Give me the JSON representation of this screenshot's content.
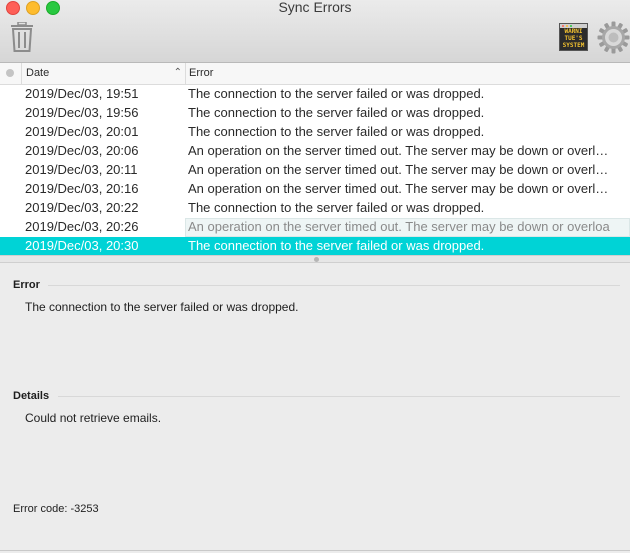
{
  "window": {
    "title": "Sync Errors"
  },
  "toolbar": {
    "console_icon_text": [
      "WARNI",
      "TUE'S",
      "SYSTEM"
    ],
    "colors": {
      "selection": "#00d3d6"
    }
  },
  "table": {
    "columns": {
      "date": "Date",
      "error": "Error"
    },
    "rows": [
      {
        "date": "2019/Dec/03, 19:51",
        "error": "The connection to the server failed or was dropped."
      },
      {
        "date": "2019/Dec/03, 19:56",
        "error": "The connection to the server failed or was dropped."
      },
      {
        "date": "2019/Dec/03, 20:01",
        "error": "The connection to the server failed or was dropped."
      },
      {
        "date": "2019/Dec/03, 20:06",
        "error": "An operation on the server timed out. The server may be down or overl…"
      },
      {
        "date": "2019/Dec/03, 20:11",
        "error": "An operation on the server timed out. The server may be down or overl…"
      },
      {
        "date": "2019/Dec/03, 20:16",
        "error": "An operation on the server timed out. The server may be down or overl…"
      },
      {
        "date": "2019/Dec/03, 20:22",
        "error": "The connection to the server failed or was dropped."
      },
      {
        "date": "2019/Dec/03, 20:26",
        "error": "An operation on the server timed out. The server may be down or overloa"
      },
      {
        "date": "2019/Dec/03, 20:30",
        "error": "The connection to the server failed or was dropped."
      }
    ]
  },
  "detail": {
    "error_title": "Error",
    "error_body": "The connection to the server failed or was dropped.",
    "details_title": "Details",
    "details_body": "Could not retrieve emails.",
    "code": "Error code: -3253"
  }
}
